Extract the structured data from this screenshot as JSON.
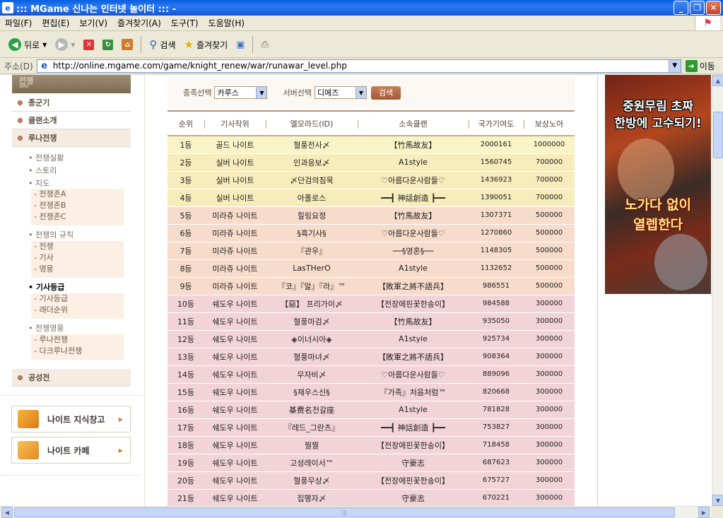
{
  "window": {
    "title": "::: MGame 신나는 인터넷 놀이터 ::: -"
  },
  "menu": [
    "파일(F)",
    "편집(E)",
    "보기(V)",
    "즐겨찾기(A)",
    "도구(T)",
    "도움말(H)"
  ],
  "toolbar": {
    "back": "뒤로",
    "search": "검색",
    "favorites": "즐겨찾기"
  },
  "address": {
    "label": "주소(D)",
    "url": "http://online.mgame.com/game/knight_renew/war/runawar_level.php",
    "go": "이동"
  },
  "sidebar": {
    "banner_title": "전쟁",
    "banner_sub": "WAR",
    "main": [
      "종군기",
      "클랜소개",
      "루나전쟁"
    ],
    "sub_group1": [
      "• 전쟁실황",
      "• 스토리",
      "• 지도"
    ],
    "map_items": [
      "- 전쟁존A",
      "- 전쟁존B",
      "- 전쟁존C"
    ],
    "rules_title": "• 전쟁의 규칙",
    "rules_items": [
      "- 전쟁",
      "- 기사",
      "- 영웅"
    ],
    "rank_title": "• 기사등급",
    "rank_items": [
      "- 기사등급",
      "- 래더순위"
    ],
    "ops_title": "• 전쟁영웅",
    "ops_items": [
      "- 루나전쟁",
      "- 다크루나전쟁"
    ],
    "siege": "공성전",
    "link1": "나이트 지식창고",
    "link2": "나이트 카페"
  },
  "search": {
    "race_label": "종족선택",
    "race_value": "카루스",
    "server_label": "서버선택",
    "server_value": "디에즈",
    "button": "검색"
  },
  "table": {
    "headers": [
      "순위",
      "기사작위",
      "엘모라드(ID)",
      "소속클랜",
      "국가기여도",
      "보상노아"
    ],
    "rows": [
      [
        "1등",
        "골드 나이트",
        "혈풍전사〆",
        "【竹馬故友】",
        "2000161",
        "1000000"
      ],
      [
        "2등",
        "실버 나이트",
        "인과응보〆",
        "A1style",
        "1560745",
        "700000"
      ],
      [
        "3등",
        "실버 나이트",
        "〆단검의침묵",
        "♡아름다운사람들♡",
        "1436923",
        "700000"
      ],
      [
        "4등",
        "실버 나이트",
        "아폴로스",
        "━━┫ 神話創造 ┣━━",
        "1390051",
        "700000"
      ],
      [
        "5등",
        "미라쥬 나이트",
        "힐링요정",
        "【竹馬故友】",
        "1307371",
        "500000"
      ],
      [
        "6등",
        "미라쥬 나이트",
        "§흑기사§",
        "♡아름다운사람들♡",
        "1270860",
        "500000"
      ],
      [
        "7등",
        "미라쥬 나이트",
        "『관우』",
        "──§영혼§──",
        "1148305",
        "500000"
      ],
      [
        "8등",
        "미라쥬 나이트",
        "LasTHerO",
        "A1style",
        "1132652",
        "500000"
      ],
      [
        "9등",
        "미라쥬 나이트",
        "『코』『알』『라』™",
        "【敗軍之將不語兵】",
        "986551",
        "500000"
      ],
      [
        "10등",
        "쉐도우 나이트",
        "【惡】 프리가이〆",
        "【전장에핀꽃한송이】",
        "984588",
        "300000"
      ],
      [
        "11등",
        "쉐도우 나이트",
        "혈풍마검〆",
        "【竹馬故友】",
        "935050",
        "300000"
      ],
      [
        "12등",
        "쉐도우 나이트",
        "◈이너시아◈",
        "A1style",
        "925734",
        "300000"
      ],
      [
        "13등",
        "쉐도우 나이트",
        "혈풍마녀〆",
        "【敗軍之將不語兵】",
        "908364",
        "300000"
      ],
      [
        "14등",
        "쉐도우 나이트",
        "무자비〆",
        "♡아름다운사람들♡",
        "889096",
        "300000"
      ],
      [
        "15등",
        "쉐도우 나이트",
        "§재우스신§",
        "『가족』처음처럼™",
        "820668",
        "300000"
      ],
      [
        "16등",
        "쉐도우 나이트",
        "棊费名전갈座",
        "A1style",
        "781828",
        "300000"
      ],
      [
        "17등",
        "쉐도우 나이트",
        "『레드_그란츠』",
        "━━┫ 神話創造 ┣━━",
        "753827",
        "300000"
      ],
      [
        "18등",
        "쉐도우 나이트",
        "찔찔",
        "【전장에핀꽃한송이】",
        "718458",
        "300000"
      ],
      [
        "19등",
        "쉐도우 나이트",
        "고성레이서™",
        "守豪志",
        "687623",
        "300000"
      ],
      [
        "20등",
        "쉐도우 나이트",
        "혈풍무상〆",
        "【전장에핀꽃한송이】",
        "675727",
        "300000"
      ],
      [
        "21등",
        "쉐도우 나이트",
        "집행자〆",
        "守豪志",
        "670221",
        "300000"
      ]
    ]
  },
  "ad": {
    "line1": "중원무림 초짜",
    "line2": "한방에 고수되기!",
    "line3": "노가다 없이",
    "line4": "열렙한다"
  },
  "colors": {
    "title_bar": "#1a5cd8",
    "gold_row": "#f9f3c8",
    "silver_row": "#f7ecbb",
    "mirage_row": "#f7dccb",
    "shadow_row": "#f2d4d8",
    "accent": "#b88f6f"
  }
}
